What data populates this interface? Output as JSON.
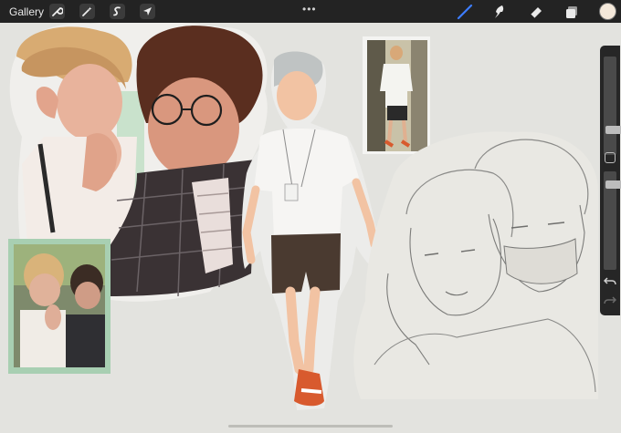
{
  "toolbar": {
    "gallery_label": "Gallery",
    "more_label": "•••",
    "left_tools": [
      "wrench-icon",
      "magic-wand-icon",
      "selection-icon",
      "transform-arrow-icon"
    ],
    "right_tools": [
      "brush-icon",
      "smudge-icon",
      "eraser-icon",
      "layers-icon"
    ],
    "active_tool": "brush-icon",
    "accent_color": "#3d7dff",
    "current_color": "#f4e8da"
  },
  "sidebar": {
    "controls": [
      "brush-size-slider",
      "modify-button",
      "opacity-slider",
      "undo-icon",
      "redo-icon"
    ]
  },
  "canvas": {
    "background_color": "#e3e3df",
    "artworks": [
      "painted-portrait-pair",
      "reference-photo-pair",
      "painted-full-body-figure",
      "reference-photo-full-body",
      "pencil-sketch-pair"
    ]
  }
}
